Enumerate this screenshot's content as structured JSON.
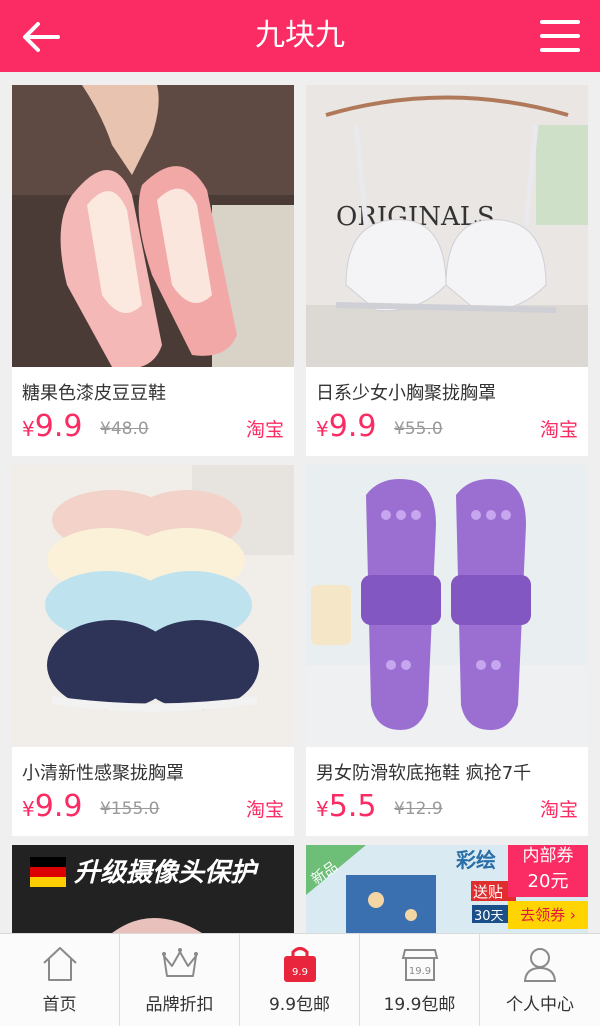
{
  "header": {
    "title": "九块九"
  },
  "products": [
    {
      "name": "糖果色漆皮豆豆鞋",
      "yen": "¥",
      "price": "9.9",
      "original": "¥48.0",
      "shop": "淘宝"
    },
    {
      "name": "日系少女小胸聚拢胸罩",
      "yen": "¥",
      "price": "9.9",
      "original": "¥55.0",
      "shop": "淘宝",
      "image_text": "ORIGINALS"
    },
    {
      "name": "小清新性感聚拢胸罩",
      "yen": "¥",
      "price": "9.9",
      "original": "¥155.0",
      "shop": "淘宝"
    },
    {
      "name": "男女防滑软底拖鞋 疯抢7千",
      "yen": "¥",
      "price": "5.5",
      "original": "¥12.9",
      "shop": "淘宝"
    },
    {
      "image_text": "升级摄像头保护"
    },
    {
      "image_badge_new": "新品",
      "image_title": "彩绘",
      "image_sale": "送贴",
      "image_count": "30天",
      "coupon_title": "内部券",
      "coupon_value": "20元",
      "coupon_action": "去领券 ›"
    }
  ],
  "tabs": [
    {
      "label": "首页",
      "icon": "home-icon"
    },
    {
      "label": "品牌折扣",
      "icon": "crown-icon"
    },
    {
      "label": "9.9包邮",
      "icon": "bag-icon",
      "badge": "9.9",
      "active_color": "#e8253d"
    },
    {
      "label": "19.9包邮",
      "icon": "store-icon",
      "badge": "19.9"
    },
    {
      "label": "个人中心",
      "icon": "person-icon"
    }
  ],
  "colors": {
    "brand": "#fb2c63"
  }
}
